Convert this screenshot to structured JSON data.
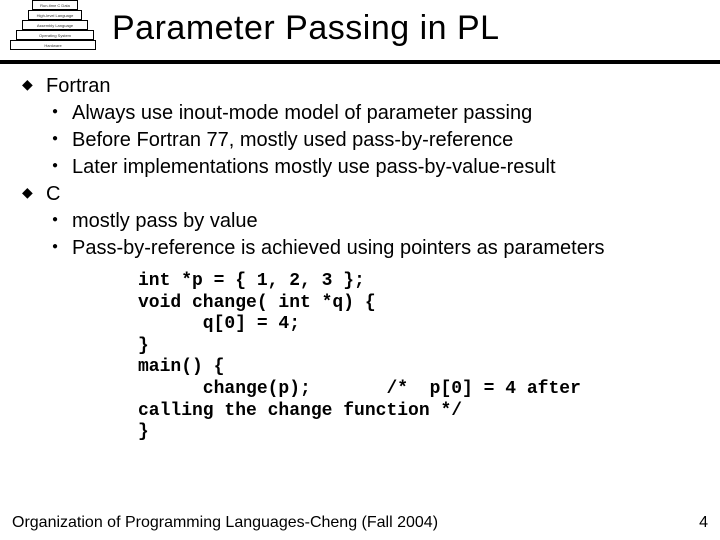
{
  "title": "Parameter Passing in PL",
  "logo": {
    "l1": "Run-time    C    Data",
    "l2": "High-level Language",
    "l3": "Assembly Language",
    "l4": "Operating System",
    "l5": "Hardware"
  },
  "bullets": {
    "fortran": {
      "label": "Fortran",
      "items": [
        "Always use inout-mode model of parameter passing",
        "Before Fortran 77, mostly used pass-by-reference",
        "Later implementations mostly use pass-by-value-result"
      ]
    },
    "c": {
      "label": "C",
      "items": [
        "mostly pass by value",
        "Pass-by-reference is achieved using pointers as parameters"
      ]
    }
  },
  "code": "int *p = { 1, 2, 3 };\nvoid change( int *q) {\n      q[0] = 4;\n}\nmain() {\n      change(p);       /*  p[0] = 4 after\ncalling the change function */\n}",
  "footer": "Organization of Programming Languages-Cheng (Fall 2004)",
  "page": "4"
}
